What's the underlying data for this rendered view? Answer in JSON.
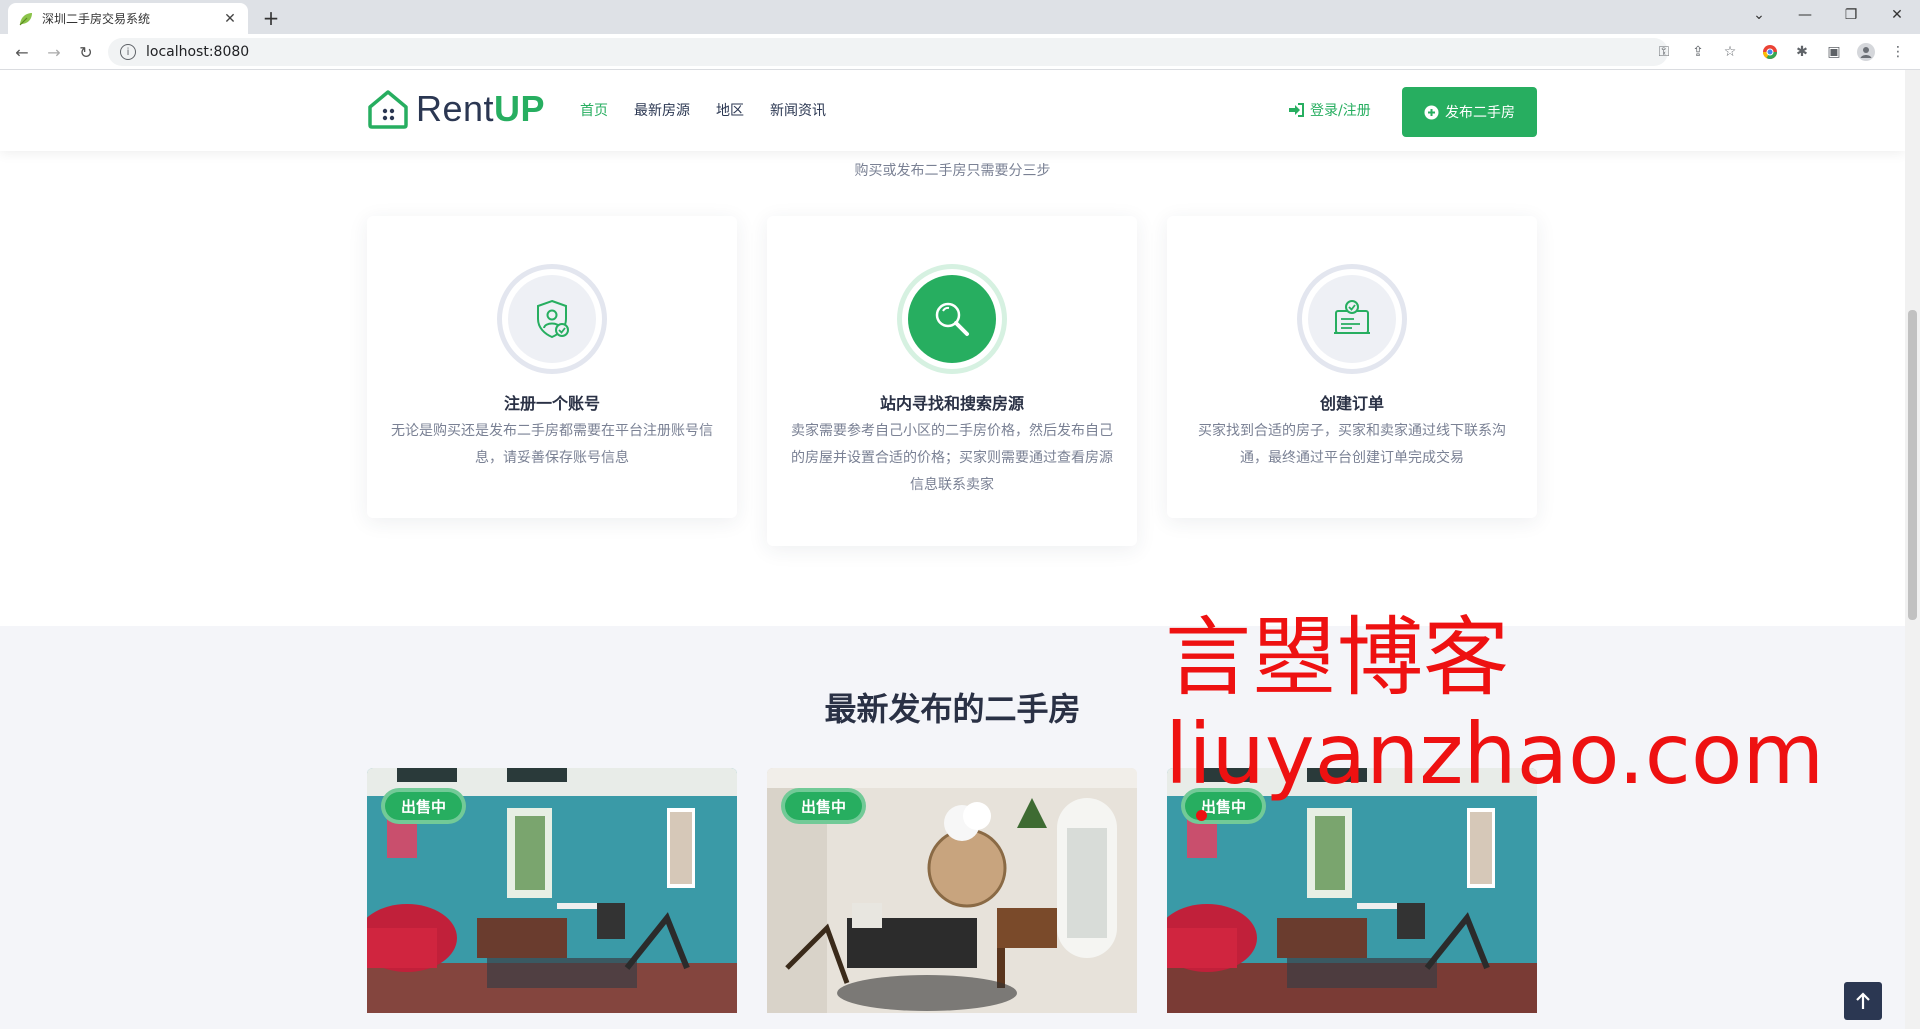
{
  "browser": {
    "tab_title": "深圳二手房交易系统",
    "url": "localhost:8080"
  },
  "header": {
    "logo_rent": "Rent",
    "logo_up": "UP",
    "nav": [
      "首页",
      "最新房源",
      "地区",
      "新闻资讯"
    ],
    "login_label": "登录/注册",
    "publish_label": "发布二手房"
  },
  "steps_section": {
    "subtitle": "购买或发布二手房只需要分三步",
    "steps": [
      {
        "icon": "shield-user-icon",
        "title": "注册一个账号",
        "desc": "无论是购买还是发布二手房都需要在平台注册账号信息，请妥善保存账号信息"
      },
      {
        "icon": "search-icon",
        "title": "站内寻找和搜索房源",
        "desc": "卖家需要参考自己小区的二手房价格，然后发布自己的房屋并设置合适的价格；买家则需要通过查看房源信息联系卖家"
      },
      {
        "icon": "contract-icon",
        "title": "创建订单",
        "desc": "买家找到合适的房子，买家和卖家通过线下联系沟通，最终通过平台创建订单完成交易"
      }
    ]
  },
  "listings": {
    "heading": "最新发布的二手房",
    "items": [
      {
        "badge": "出售中"
      },
      {
        "badge": "出售中"
      },
      {
        "badge": "出售中"
      }
    ]
  },
  "watermark": {
    "line1": "言曌博客",
    "line2": "liuyanzhao.com"
  },
  "colors": {
    "brand": "#27ae60",
    "dark": "#2b3752",
    "watermark": "#ee1111"
  }
}
